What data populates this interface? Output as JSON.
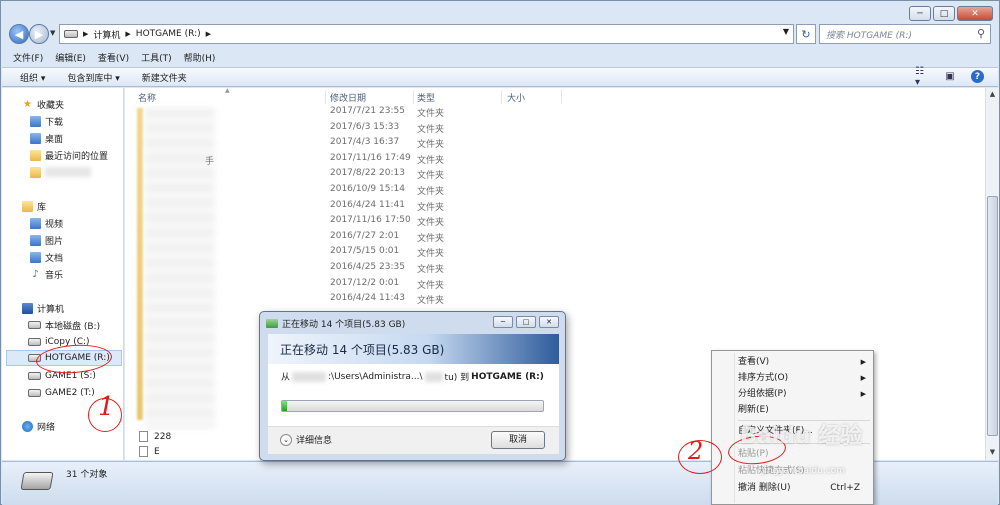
{
  "window": {
    "controls": {
      "minimize": "─",
      "maximize": "□",
      "close": "✕"
    }
  },
  "address_bar": {
    "crumbs": [
      "计算机",
      "HOTGAME (R:)"
    ],
    "search_placeholder": "搜索 HOTGAME (R:)"
  },
  "menubar": [
    "文件(F)",
    "编辑(E)",
    "查看(V)",
    "工具(T)",
    "帮助(H)"
  ],
  "commandbar": {
    "organize": "组织 ▾",
    "include_library": "包含到库中 ▾",
    "new_folder": "新建文件夹"
  },
  "navpane": {
    "favorites": {
      "label": "收藏夹",
      "items": [
        "下载",
        "桌面",
        "最近访问的位置"
      ]
    },
    "libraries": {
      "label": "库",
      "items": [
        "视频",
        "图片",
        "文档",
        "音乐"
      ]
    },
    "computer": {
      "label": "计算机",
      "items": [
        "本地磁盘 (B:)",
        "iCopy (C:)",
        "HOTGAME (R:)",
        "GAME1 (S:)",
        "GAME2 (T:)"
      ]
    },
    "network": {
      "label": "网络"
    }
  },
  "columns": {
    "name": "名称",
    "date": "修改日期",
    "type": "类型",
    "size": "大小"
  },
  "rows": [
    {
      "date": "2017/7/21 23:55",
      "type": "文件夹"
    },
    {
      "date": "2017/6/3 15:33",
      "type": "文件夹"
    },
    {
      "date": "2017/4/3 16:37",
      "type": "文件夹"
    },
    {
      "date": "2017/11/16 17:49",
      "type": "文件夹"
    },
    {
      "date": "2017/8/22 20:13",
      "type": "文件夹"
    },
    {
      "date": "2016/10/9 15:14",
      "type": "文件夹"
    },
    {
      "date": "2016/4/24 11:41",
      "type": "文件夹"
    },
    {
      "date": "2017/11/16 17:50",
      "type": "文件夹"
    },
    {
      "date": "2016/7/27 2:01",
      "type": "文件夹"
    },
    {
      "date": "2017/5/15 0:01",
      "type": "文件夹"
    },
    {
      "date": "2016/4/25 23:35",
      "type": "文件夹"
    },
    {
      "date": "2017/12/2 0:01",
      "type": "文件夹"
    },
    {
      "date": "2016/4/24 11:43",
      "type": "文件夹"
    }
  ],
  "blurred_fragment": "手",
  "files": [
    "228",
    "E"
  ],
  "status": {
    "count": "31 个对象"
  },
  "dialog": {
    "title": "正在移动 14 个项目(5.83 GB)",
    "heading": "正在移动 14 个项目(5.83 GB)",
    "from_prefix": "从",
    "from_mid": ":\\Users\\Administra...\\",
    "from_suffix": "tu) 到",
    "dest": "HOTGAME (R:)",
    "progress": 0.02,
    "details": "详细信息",
    "cancel": "取消"
  },
  "context_menu": {
    "items": [
      {
        "label": "查看(V)",
        "submenu": true,
        "disabled": false
      },
      {
        "label": "排序方式(O)",
        "submenu": true,
        "disabled": false
      },
      {
        "label": "分组依据(P)",
        "submenu": true,
        "disabled": false
      },
      {
        "label": "刷新(E)",
        "submenu": false,
        "disabled": false
      },
      {
        "label": "自定义文件夹(F)...",
        "submenu": false,
        "disabled": false
      },
      {
        "label": "粘贴(P)",
        "submenu": false,
        "disabled": true
      },
      {
        "label": "粘贴快捷方式(S)",
        "submenu": false,
        "disabled": true
      },
      {
        "label": "撤消 删除(U)",
        "shortcut": "Ctrl+Z",
        "submenu": false,
        "disabled": false
      }
    ]
  },
  "annotations": {
    "mark1": "1",
    "mark2": "2"
  },
  "watermark": {
    "brand": "Baidu 经验",
    "url": "jingyan.baidu.com"
  },
  "colors": {
    "annotation_red": "#e21b1b",
    "progress_green": "#1fa21f",
    "selection_blue": "#dce9f8"
  }
}
